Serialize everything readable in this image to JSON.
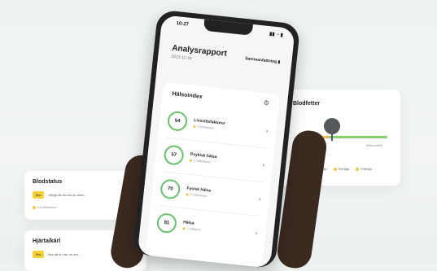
{
  "phone": {
    "status_time": "10:27",
    "status_icons": "▮▮ ◔ ▮",
    "title": "Analysrapport",
    "date": "2023-11-29",
    "action": "Sammanfattning",
    "action_icon": "download-icon",
    "section_title": "Hälsoindex",
    "section_icon": "gear-icon",
    "items": [
      {
        "score": "54",
        "label": "Livsstilsfaktorer",
        "sub": "4 indikationer"
      },
      {
        "score": "57",
        "label": "Psykisk hälsa",
        "sub": "2 indikationer"
      },
      {
        "score": "70",
        "label": "Fysisk hälsa",
        "sub": "3 indikationer"
      },
      {
        "score": "81",
        "label": "Hälsa",
        "sub": "1 indikation"
      }
    ]
  },
  "right_card": {
    "title": "Blodfetter",
    "bar_label": "Målområde",
    "legend": [
      "Förhöjd",
      "Förhöjd",
      "Förhöjd"
    ],
    "colors": {
      "green": "#86cf6e",
      "orange": "#f1b75a",
      "marker": "#55585c"
    }
  },
  "left_card1": {
    "title": "Blodstatus",
    "pill": "Bra",
    "text": "Viktigt att du bar du med...",
    "sub": "2 indikationer"
  },
  "left_card2": {
    "title": "Hjärta/kärl",
    "pill": "Bra",
    "text": "Bra att du har du ma..."
  }
}
